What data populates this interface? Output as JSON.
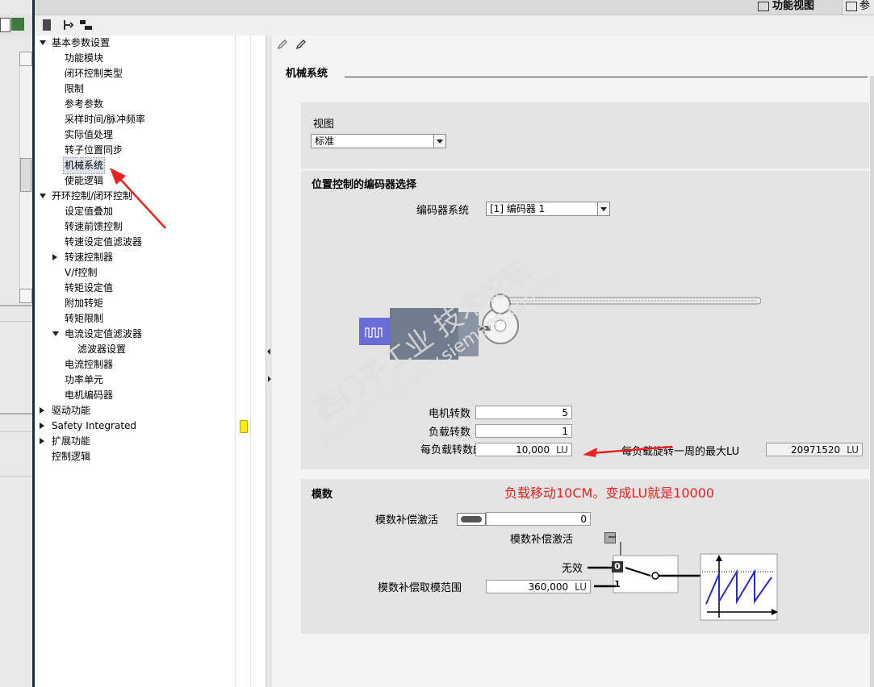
{
  "tabs": {
    "function_view": "功能视图",
    "params": "参"
  },
  "tree": [
    {
      "label": "基本参数设置",
      "level": 0,
      "expander": "down"
    },
    {
      "label": "功能模块",
      "level": 1
    },
    {
      "label": "闭环控制类型",
      "level": 1
    },
    {
      "label": "限制",
      "level": 1
    },
    {
      "label": "参考参数",
      "level": 1
    },
    {
      "label": "采样时间/脉冲频率",
      "level": 1
    },
    {
      "label": "实际值处理",
      "level": 1
    },
    {
      "label": "转子位置同步",
      "level": 1
    },
    {
      "label": "机械系统",
      "level": 1,
      "selected": true
    },
    {
      "label": "使能逻辑",
      "level": 1
    },
    {
      "label": "开环控制/闭环控制",
      "level": 0,
      "expander": "down"
    },
    {
      "label": "设定值叠加",
      "level": 1
    },
    {
      "label": "转速前馈控制",
      "level": 1
    },
    {
      "label": "转速设定值滤波器",
      "level": 1
    },
    {
      "label": "转速控制器",
      "level": 1,
      "expander": "right"
    },
    {
      "label": "V/f控制",
      "level": 1
    },
    {
      "label": "转矩设定值",
      "level": 1
    },
    {
      "label": "附加转矩",
      "level": 1
    },
    {
      "label": "转矩限制",
      "level": 1
    },
    {
      "label": "电流设定值滤波器",
      "level": 1,
      "expander": "down"
    },
    {
      "label": "滤波器设置",
      "level": 2
    },
    {
      "label": "电流控制器",
      "level": 1
    },
    {
      "label": "功率单元",
      "level": 1
    },
    {
      "label": "电机编码器",
      "level": 1
    },
    {
      "label": "驱动功能",
      "level": 0,
      "expander": "right"
    },
    {
      "label": "Safety Integrated",
      "level": 0,
      "expander": "right",
      "warning": true
    },
    {
      "label": "扩展功能",
      "level": 0,
      "expander": "right"
    },
    {
      "label": "控制逻辑",
      "level": 0
    }
  ],
  "main": {
    "title": "机械系统",
    "view_label": "视图",
    "view_value": "标准",
    "encoder_section": "位置控制的编码器选择",
    "encoder_label": "编码器系统",
    "encoder_value": "[1] 编码器 1",
    "motor_rev_label": "电机转数",
    "motor_rev_value": "5",
    "load_rev_label": "负载转数",
    "load_rev_value": "1",
    "lu_per_rev_label": "每负载转数的 LU",
    "lu_per_rev_value": "10,000",
    "lu_unit": "LU",
    "max_label": "每负载旋转一周的最大LU",
    "max_value": "20971520",
    "modulo_section": "模数",
    "modulo_activate_label": "模数补偿激活",
    "modulo_activate_value": "0",
    "modulo_activate_label2": "模数补偿激活",
    "invalid_label": "无效",
    "switch_0": "0",
    "switch_1": "1",
    "modulo_range_label": "模数补偿取模范围",
    "modulo_range_value": "360,000",
    "note": "负载移动10CM。变成LU就是10000"
  },
  "watermark": {
    "cn": "西门子工业 技术论坛",
    "url": "support.industry.siemens.com/cs"
  },
  "colors": {
    "annotation_red": "#e8231f",
    "motor_purple": "#6b6bd9",
    "motor_gray": "#707b8c",
    "chart_blue": "#2a2acf"
  }
}
